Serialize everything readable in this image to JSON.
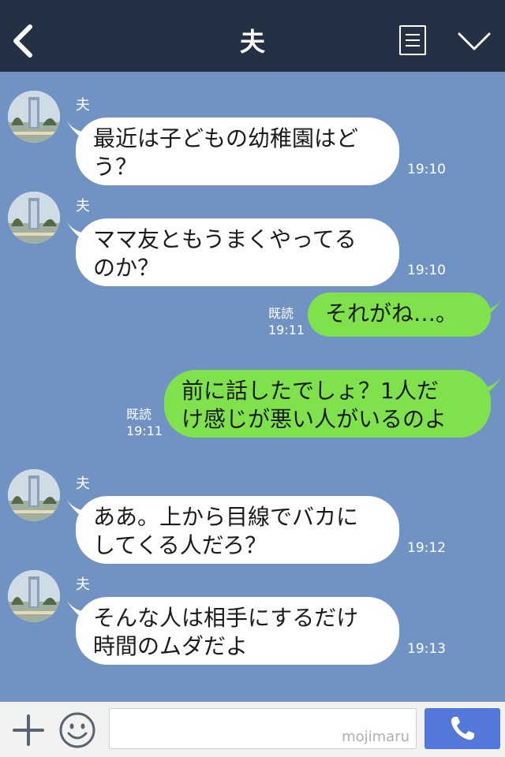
{
  "header": {
    "title": "夫"
  },
  "messages": [
    {
      "sender": "夫",
      "line1": "最近は子どもの幼稚園はど",
      "line2": "う？",
      "time": "19:10"
    },
    {
      "sender": "夫",
      "line1": "ママ友ともうまくやってる",
      "line2": "のか？",
      "time": "19:10"
    },
    {
      "line1": "それがね…。",
      "read": "既読",
      "time": "19:11"
    },
    {
      "line1": "前に話したでしょ？1人だ",
      "line2": "け感じが悪い人がいるのよ",
      "read": "既読",
      "time": "19:11"
    },
    {
      "sender": "夫",
      "line1": "ああ。上から目線でバカに",
      "line2": "してくる人だろ？",
      "time": "19:12"
    },
    {
      "sender": "夫",
      "line1": "そんな人は相手にするだけ",
      "line2": "時間のムダだよ",
      "time": "19:13"
    }
  ],
  "footer": {
    "watermark": "mojimaru"
  },
  "colors": {
    "header_bg": "#243044",
    "chat_bg": "#7193c3",
    "outgoing_bubble": "#7fe24c",
    "incoming_bubble": "#ffffff",
    "send_button": "#5478d9"
  },
  "icons": {
    "back": "chevron-left-icon",
    "menu": "note-icon",
    "expand": "chevron-down-icon",
    "add": "plus-icon",
    "emoji": "smiley-icon",
    "call": "phone-icon"
  }
}
